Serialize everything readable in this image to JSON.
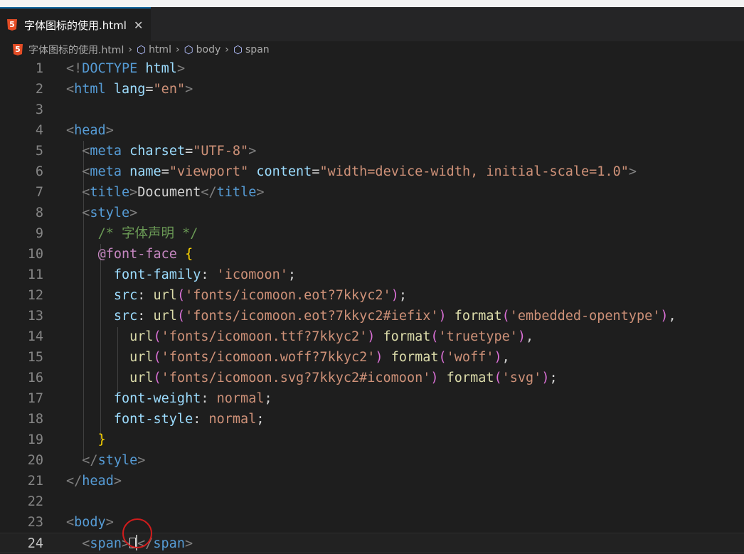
{
  "tab": {
    "label": "字体图标的使用.html",
    "icon": "html5-icon",
    "close_glyph": "✕"
  },
  "breadcrumb": [
    "字体图标的使用.html",
    "html",
    "body",
    "span"
  ],
  "code_lines": [
    {
      "n": "1",
      "t": [
        [
          "b",
          "<!"
        ],
        [
          "tag",
          "DOCTYPE "
        ],
        [
          "attr",
          "html"
        ],
        [
          "b",
          ">"
        ]
      ]
    },
    {
      "n": "2",
      "t": [
        [
          "b",
          "<"
        ],
        [
          "tag",
          "html "
        ],
        [
          "attr",
          "lang"
        ],
        [
          "pun",
          "="
        ],
        [
          "str",
          "\"en\""
        ],
        [
          "b",
          ">"
        ]
      ]
    },
    {
      "n": "3",
      "t": []
    },
    {
      "n": "4",
      "t": [
        [
          "b",
          "<"
        ],
        [
          "tag",
          "head"
        ],
        [
          "b",
          ">"
        ]
      ]
    },
    {
      "n": "5",
      "t": [
        [
          "txt",
          "  "
        ],
        [
          "b",
          "<"
        ],
        [
          "tag",
          "meta "
        ],
        [
          "attr",
          "charset"
        ],
        [
          "pun",
          "="
        ],
        [
          "str",
          "\"UTF-8\""
        ],
        [
          "b",
          ">"
        ]
      ]
    },
    {
      "n": "6",
      "t": [
        [
          "txt",
          "  "
        ],
        [
          "b",
          "<"
        ],
        [
          "tag",
          "meta "
        ],
        [
          "attr",
          "name"
        ],
        [
          "pun",
          "="
        ],
        [
          "str",
          "\"viewport\" "
        ],
        [
          "attr",
          "content"
        ],
        [
          "pun",
          "="
        ],
        [
          "str",
          "\"width=device-width, initial-scale=1.0\""
        ],
        [
          "b",
          ">"
        ]
      ]
    },
    {
      "n": "7",
      "t": [
        [
          "txt",
          "  "
        ],
        [
          "b",
          "<"
        ],
        [
          "tag",
          "title"
        ],
        [
          "b",
          ">"
        ],
        [
          "txt",
          "Document"
        ],
        [
          "b",
          "</"
        ],
        [
          "tag",
          "title"
        ],
        [
          "b",
          ">"
        ]
      ]
    },
    {
      "n": "8",
      "t": [
        [
          "txt",
          "  "
        ],
        [
          "b",
          "<"
        ],
        [
          "tag",
          "style"
        ],
        [
          "b",
          ">"
        ]
      ]
    },
    {
      "n": "9",
      "t": [
        [
          "txt",
          "    "
        ],
        [
          "com",
          "/* 字体声明 */"
        ]
      ]
    },
    {
      "n": "10",
      "t": [
        [
          "txt",
          "    "
        ],
        [
          "at",
          "@font-face "
        ],
        [
          "br",
          "{"
        ]
      ]
    },
    {
      "n": "11",
      "t": [
        [
          "txt",
          "      "
        ],
        [
          "attr",
          "font-family"
        ],
        [
          "pun",
          ": "
        ],
        [
          "str",
          "'icomoon'"
        ],
        [
          "pun",
          ";"
        ]
      ]
    },
    {
      "n": "12",
      "t": [
        [
          "txt",
          "      "
        ],
        [
          "attr",
          "src"
        ],
        [
          "pun",
          ": "
        ],
        [
          "fn",
          "url"
        ],
        [
          "pr",
          "("
        ],
        [
          "str",
          "'fonts/icomoon.eot?7kkyc2'"
        ],
        [
          "pr",
          ")"
        ],
        [
          "pun",
          ";"
        ]
      ]
    },
    {
      "n": "13",
      "t": [
        [
          "txt",
          "      "
        ],
        [
          "attr",
          "src"
        ],
        [
          "pun",
          ": "
        ],
        [
          "fn",
          "url"
        ],
        [
          "pr",
          "("
        ],
        [
          "str",
          "'fonts/icomoon.eot?7kkyc2#iefix'"
        ],
        [
          "pr",
          ") "
        ],
        [
          "fn",
          "format"
        ],
        [
          "pr",
          "("
        ],
        [
          "str",
          "'embedded-opentype'"
        ],
        [
          "pr",
          ")"
        ],
        [
          "pun",
          ","
        ]
      ]
    },
    {
      "n": "14",
      "t": [
        [
          "txt",
          "        "
        ],
        [
          "fn",
          "url"
        ],
        [
          "pr",
          "("
        ],
        [
          "str",
          "'fonts/icomoon.ttf?7kkyc2'"
        ],
        [
          "pr",
          ") "
        ],
        [
          "fn",
          "format"
        ],
        [
          "pr",
          "("
        ],
        [
          "str",
          "'truetype'"
        ],
        [
          "pr",
          ")"
        ],
        [
          "pun",
          ","
        ]
      ]
    },
    {
      "n": "15",
      "t": [
        [
          "txt",
          "        "
        ],
        [
          "fn",
          "url"
        ],
        [
          "pr",
          "("
        ],
        [
          "str",
          "'fonts/icomoon.woff?7kkyc2'"
        ],
        [
          "pr",
          ") "
        ],
        [
          "fn",
          "format"
        ],
        [
          "pr",
          "("
        ],
        [
          "str",
          "'woff'"
        ],
        [
          "pr",
          ")"
        ],
        [
          "pun",
          ","
        ]
      ]
    },
    {
      "n": "16",
      "t": [
        [
          "txt",
          "        "
        ],
        [
          "fn",
          "url"
        ],
        [
          "pr",
          "("
        ],
        [
          "str",
          "'fonts/icomoon.svg?7kkyc2#icomoon'"
        ],
        [
          "pr",
          ") "
        ],
        [
          "fn",
          "format"
        ],
        [
          "pr",
          "("
        ],
        [
          "str",
          "'svg'"
        ],
        [
          "pr",
          ")"
        ],
        [
          "pun",
          ";"
        ]
      ]
    },
    {
      "n": "17",
      "t": [
        [
          "txt",
          "      "
        ],
        [
          "attr",
          "font-weight"
        ],
        [
          "pun",
          ": "
        ],
        [
          "str",
          "normal"
        ],
        [
          "pun",
          ";"
        ]
      ]
    },
    {
      "n": "18",
      "t": [
        [
          "txt",
          "      "
        ],
        [
          "attr",
          "font-style"
        ],
        [
          "pun",
          ": "
        ],
        [
          "str",
          "normal"
        ],
        [
          "pun",
          ";"
        ]
      ]
    },
    {
      "n": "19",
      "t": [
        [
          "txt",
          "    "
        ],
        [
          "br",
          "}"
        ]
      ]
    },
    {
      "n": "20",
      "t": [
        [
          "txt",
          "  "
        ],
        [
          "b",
          "</"
        ],
        [
          "tag",
          "style"
        ],
        [
          "b",
          ">"
        ]
      ]
    },
    {
      "n": "21",
      "t": [
        [
          "b",
          "</"
        ],
        [
          "tag",
          "head"
        ],
        [
          "b",
          ">"
        ]
      ]
    },
    {
      "n": "22",
      "t": []
    },
    {
      "n": "23",
      "t": [
        [
          "b",
          "<"
        ],
        [
          "tag",
          "body"
        ],
        [
          "b",
          ">"
        ]
      ]
    },
    {
      "n": "24",
      "t": [
        [
          "txt",
          "  "
        ],
        [
          "b",
          "<"
        ],
        [
          "tag",
          "span"
        ],
        [
          "b",
          ">"
        ],
        [
          "glyph",
          ""
        ],
        [
          "cursor",
          ""
        ],
        [
          "b",
          "</"
        ],
        [
          "tag",
          "span"
        ],
        [
          "b",
          ">"
        ]
      ]
    }
  ],
  "current_line": "24",
  "colors": {
    "background": "#1e1e1e",
    "tag": "#569cd6",
    "attribute": "#9cdcfe",
    "string": "#ce9178",
    "comment": "#6a9955",
    "at_rule": "#c586c0",
    "function": "#dcdcaa",
    "bracket": "#ffd700",
    "highlight_circle": "#d01c1c"
  }
}
